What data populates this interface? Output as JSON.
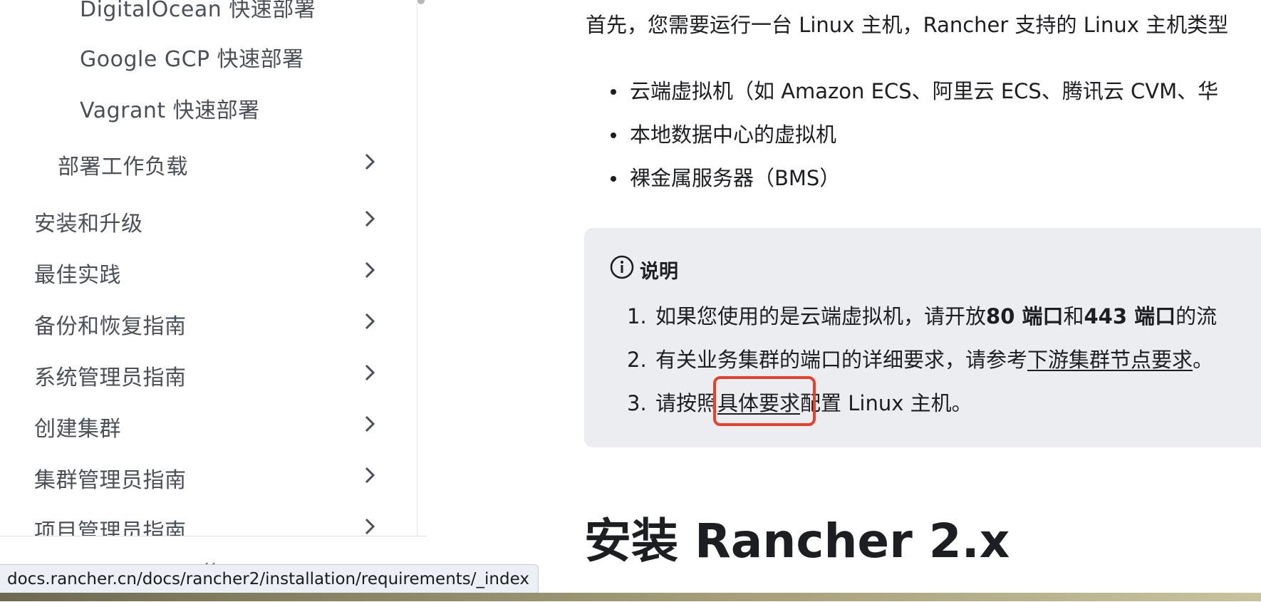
{
  "sidebar": {
    "sub_items": [
      "DigitalOcean 快速部署",
      "Google GCP 快速部署",
      "Vagrant 快速部署"
    ],
    "mid_item": "部署工作负载",
    "top_items": [
      "安装和升级",
      "最佳实践",
      "备份和恢复指南",
      "系统管理员指南",
      "创建集群",
      "集群管理员指南",
      "项目管理员指南"
    ],
    "collapse_icon": "«"
  },
  "status_url": "docs.rancher.cn/docs/rancher2/installation/requirements/_index",
  "content": {
    "intro": "首先，您需要运行一台 Linux 主机，Rancher 支持的 Linux 主机类型",
    "bullets": [
      "云端虚拟机（如 Amazon ECS、阿里云 ECS、腾讯云 CVM、华",
      "本地数据中心的虚拟机",
      "裸金属服务器（BMS）"
    ],
    "note": {
      "title": "说明",
      "items": [
        {
          "num": "1.",
          "a": "如果您使用的是云端虚拟机，请开放 ",
          "b1": "80 端口",
          "c": "和 ",
          "b2": "443 端口",
          "d": "的流"
        },
        {
          "num": "2.",
          "a": "有关业务集群的端口的详细要求，请参考",
          "link": "下游集群节点要求",
          "d": "。"
        },
        {
          "num": "3.",
          "a": "请按照",
          "link": "具体要求",
          "d": "配置 Linux 主机。"
        }
      ]
    },
    "heading": "安装 Rancher 2.x"
  },
  "colors": {
    "highlight": "#e5412f",
    "note_bg": "#ebedf0",
    "sidebar_text": "#4b4f56"
  }
}
